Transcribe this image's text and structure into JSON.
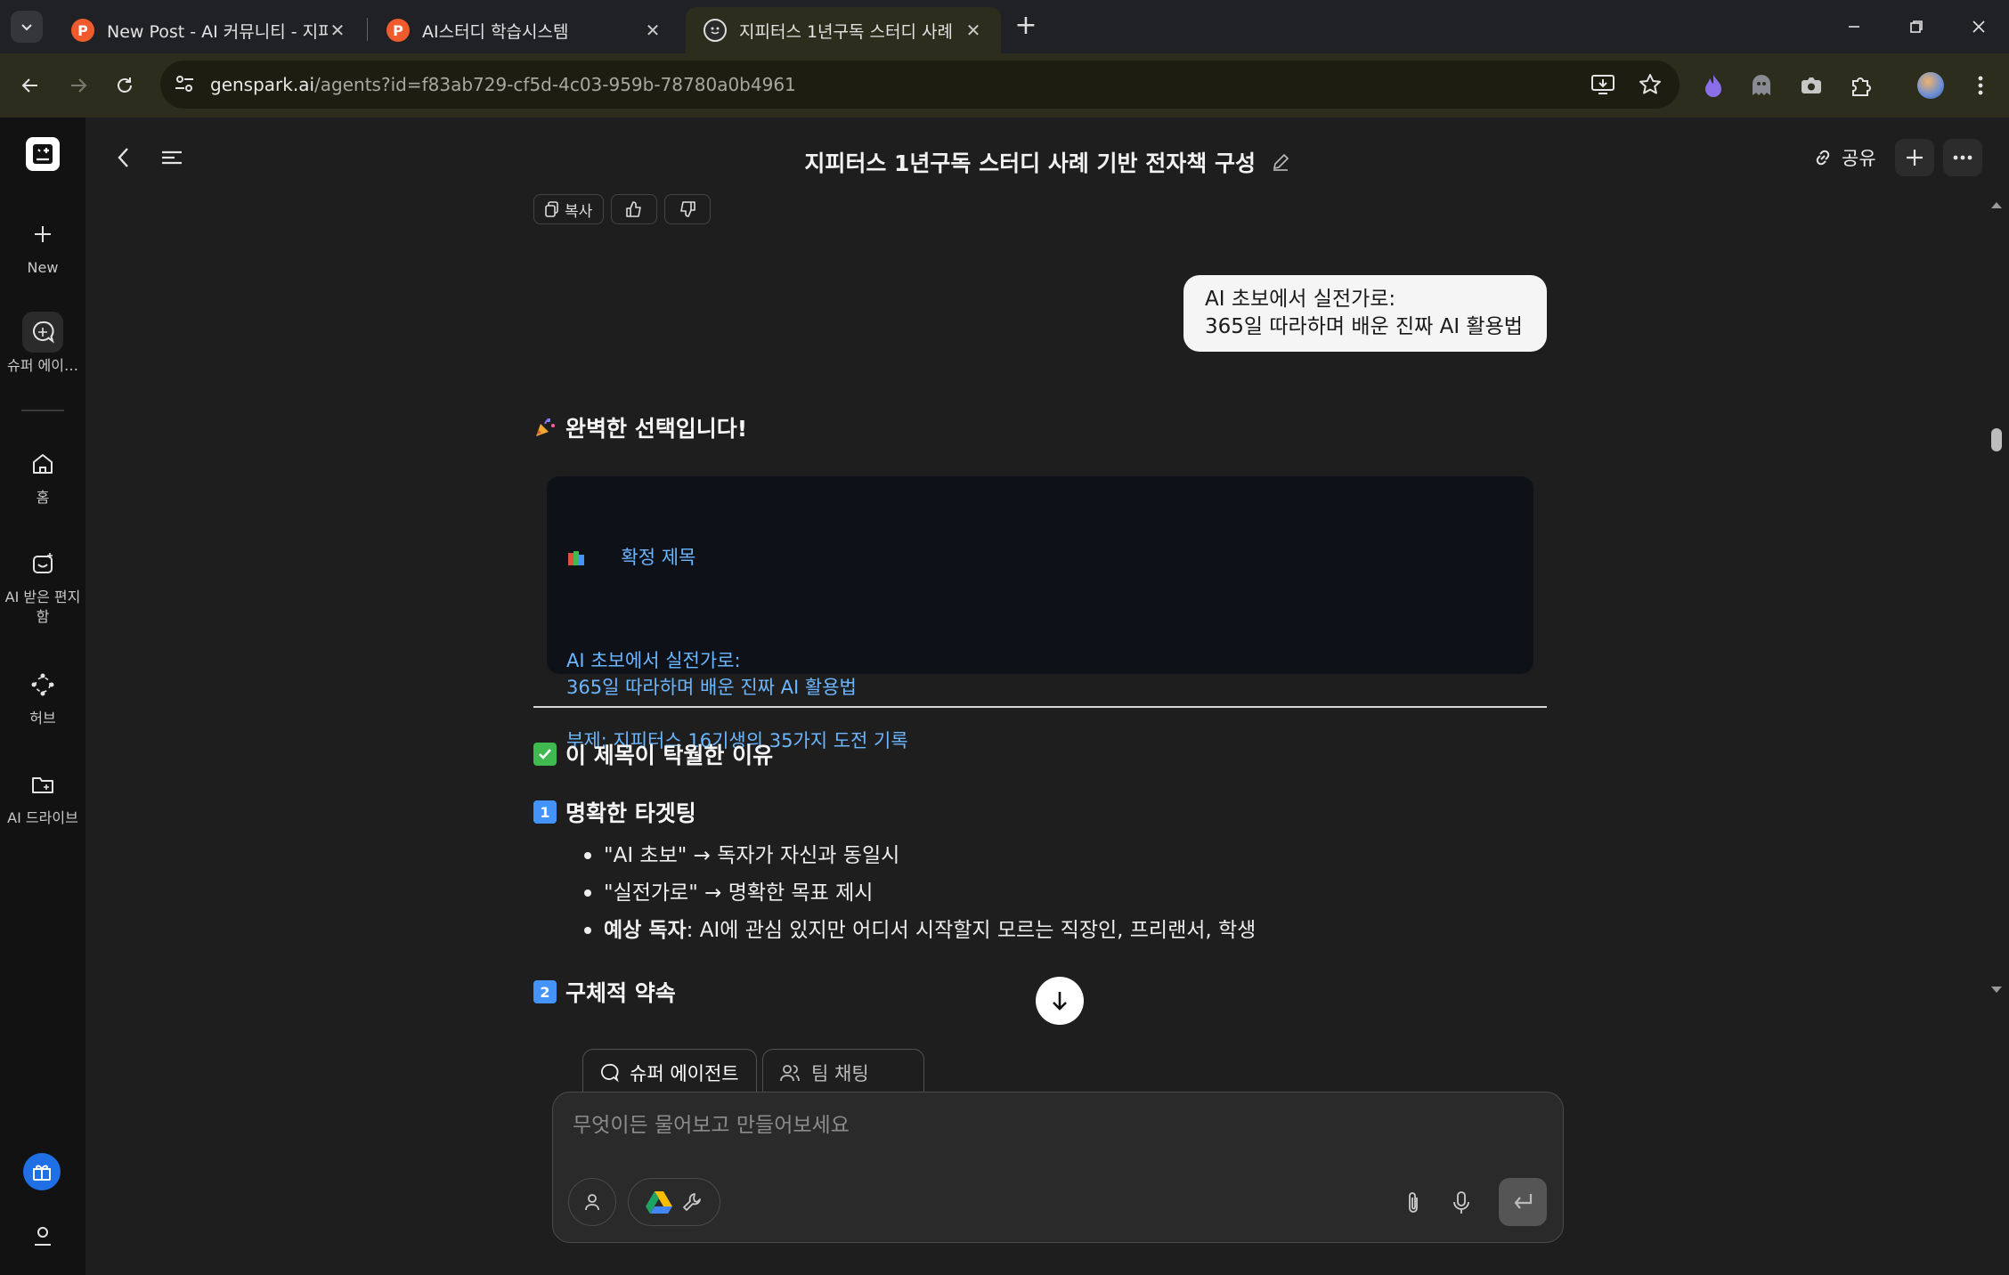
{
  "browser": {
    "tabs": [
      {
        "title": "New Post - AI 커뮤니티 - 지피",
        "active": false
      },
      {
        "title": "AI스터디 학습시스템",
        "active": false
      },
      {
        "title": "지피터스 1년구독 스터디 사례",
        "active": true
      }
    ],
    "url_host": "genspark.ai",
    "url_path": "/agents?id=f83ab729-cf5d-4c03-959b-78780a0b4961"
  },
  "sidebar": {
    "new_label": "New",
    "items": [
      {
        "label": "슈퍼 에이…",
        "icon": "super-agent-icon",
        "active": true
      },
      {
        "label": "홈",
        "icon": "home-icon",
        "active": false
      },
      {
        "label": "AI 받은 편지함",
        "icon": "ai-inbox-icon",
        "active": false
      },
      {
        "label": "허브",
        "icon": "hub-icon",
        "active": false
      },
      {
        "label": "AI 드라이브",
        "icon": "ai-drive-icon",
        "active": false
      }
    ]
  },
  "header": {
    "title": "지피터스 1년구독 스터디 사례 기반 전자책 구성",
    "share_label": "공유"
  },
  "message_actions": {
    "copy_label": "복사"
  },
  "user_message": {
    "line1": "AI 초보에서 실전가로:",
    "line2": "365일 따라하며 배운 진짜 AI 활용법"
  },
  "response": {
    "heading": "완벽한 선택입니다!",
    "code_block": {
      "title": "확정 제목",
      "line1": "AI 초보에서 실전가로:",
      "line2": "365일 따라하며 배운 진짜 AI 활용법",
      "subtitle": "부제: 지피터스 16기생의 35가지 도전 기록"
    },
    "section_heading": "이 제목이 탁월한 이유",
    "point1": {
      "number": "1",
      "title": "명확한 타겟팅",
      "bullets": [
        {
          "bold": "",
          "text": "\"AI 초보\" → 독자가 자신과 동일시"
        },
        {
          "bold": "",
          "text": "\"실전가로\" → 명확한 목표 제시"
        },
        {
          "bold": "예상 독자",
          "text": ": AI에 관심 있지만 어디서 시작할지 모르는 직장인, 프리랜서, 학생"
        }
      ]
    },
    "point2": {
      "number": "2",
      "title": "구체적 약속"
    }
  },
  "composer": {
    "tabs": [
      {
        "label": "슈퍼 에이전트",
        "active": true
      },
      {
        "label": "팀 채팅",
        "active": false
      }
    ],
    "placeholder": "무엇이든 물어보고 만들어보세요"
  },
  "colors": {
    "accent_blue": "#6cb6ff",
    "check_green": "#3fb950",
    "number_blue": "#4493f8",
    "gift_blue": "#1f6fe5",
    "tab_active_bg": "#2d2d1e"
  }
}
